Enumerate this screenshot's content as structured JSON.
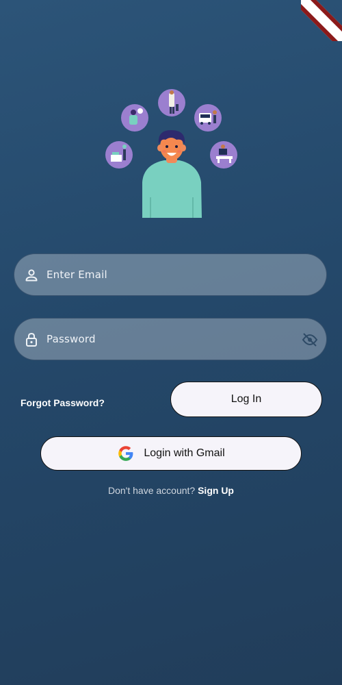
{
  "login_form": {
    "email_placeholder": "Enter Email",
    "password_placeholder": "Password",
    "forgot_password": "Forgot Password?",
    "login_button": "Log In",
    "gmail_button": "Login with Gmail",
    "signup_prompt": "Don't have account?",
    "signup_link": "Sign Up"
  },
  "icons": {
    "email": "person-icon",
    "password": "lock-icon",
    "visibility": "eye-off-icon",
    "gmail": "google-icon"
  },
  "colors": {
    "background_top": "#2c5478",
    "background_bottom": "#213d5a",
    "field_fill": "#5f7f99",
    "button_fill": "#f6f4fa",
    "illustration_circle": "#9b7fcf",
    "shirt": "#79d0c0"
  }
}
